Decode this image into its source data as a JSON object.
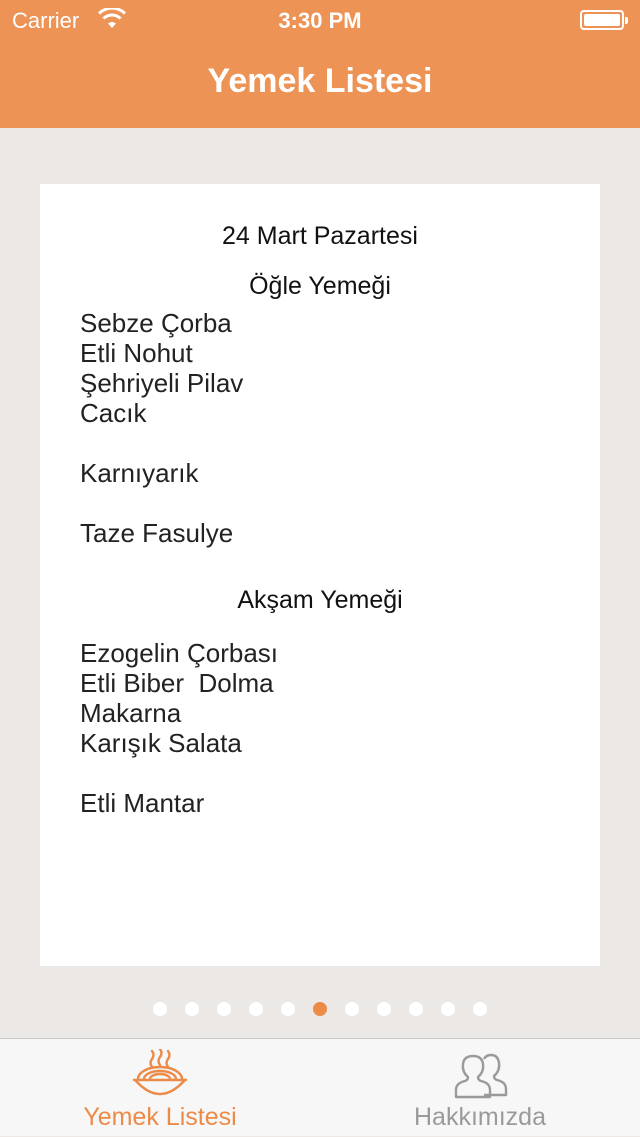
{
  "statusbar": {
    "carrier": "Carrier",
    "time": "3:30 PM"
  },
  "navbar": {
    "title": "Yemek Listesi"
  },
  "card": {
    "date": "24 Mart Pazartesi",
    "lunch": {
      "title": "Öğle Yemeği",
      "groups": [
        [
          "Sebze Çorba",
          "Etli Nohut",
          "Şehriyeli Pilav",
          "Cacık"
        ],
        [
          "Karnıyarık"
        ],
        [
          "Taze Fasulye"
        ]
      ]
    },
    "dinner": {
      "title": "Akşam Yemeği",
      "groups": [
        [
          "Ezogelin Çorbası",
          "Etli Biber  Dolma",
          "Makarna",
          "Karışık Salata"
        ],
        [
          "Etli Mantar"
        ]
      ]
    }
  },
  "pager": {
    "total": 11,
    "current_index": 5,
    "active_color": "#ec8a48"
  },
  "tabs": [
    {
      "label": "Yemek Listesi",
      "icon": "food-bowl-icon",
      "active": true
    },
    {
      "label": "Hakkımızda",
      "icon": "people-icon",
      "active": false
    }
  ],
  "colors": {
    "accent": "#ec9355",
    "background": "#ebe8e5"
  }
}
